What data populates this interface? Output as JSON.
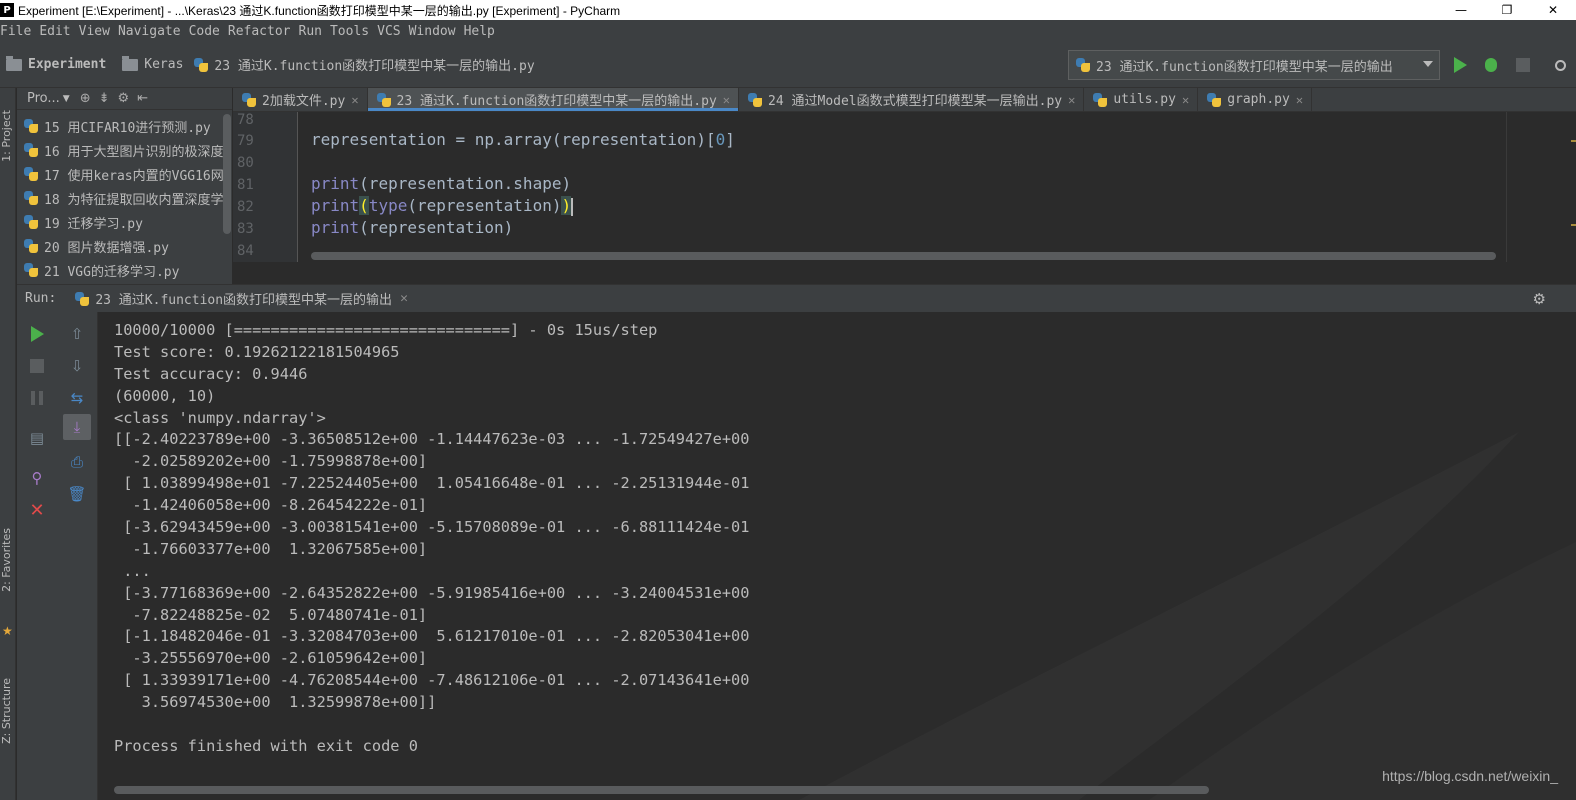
{
  "window": {
    "title": "Experiment [E:\\Experiment] - ...\\Keras\\23 通过K.function函数打印模型中某一层的输出.py [Experiment] - PyCharm",
    "controls": [
      "—",
      "❐",
      "✕"
    ]
  },
  "menu": [
    "File",
    "Edit",
    "View",
    "Navigate",
    "Code",
    "Refactor",
    "Run",
    "Tools",
    "VCS",
    "Window",
    "Help"
  ],
  "breadcrumb": {
    "project": "Experiment",
    "folder": "Keras",
    "file": "23 通过K.function函数打印模型中某一层的输出.py"
  },
  "run_config": {
    "label": "23 通过K.function函数打印模型中某一层的输出"
  },
  "project_panel": {
    "title": "Pro...",
    "items": [
      "15 用CIFAR10进行预测.py",
      "16 用于大型图片识别的极深度",
      "17 使用keras内置的VGG16网",
      "18 为特征提取回收内置深度学",
      "19 迁移学习.py",
      "20 图片数据增强.py",
      "21 VGG的迁移学习.py"
    ]
  },
  "side_strip": {
    "project": "1: Project",
    "favorites": "2: Favorites",
    "structure": "Z: Structure"
  },
  "tabs": [
    {
      "label": "2加载文件.py",
      "active": false
    },
    {
      "label": "23 通过K.function函数打印模型中某一层的输出.py",
      "active": true
    },
    {
      "label": "24 通过Model函数式模型打印模型某一层输出.py",
      "active": false
    },
    {
      "label": "utils.py",
      "active": false
    },
    {
      "label": "graph.py",
      "active": false
    }
  ],
  "editor": {
    "line_numbers": [
      "78",
      "79",
      "80",
      "81",
      "82",
      "83",
      "84"
    ],
    "line79": {
      "a": "representation = np.array(representation)[",
      "b": "0",
      "c": "]"
    },
    "line81": {
      "fn": "print",
      "rest": "(representation.shape)"
    },
    "line82": {
      "fn": "print",
      "open": "(",
      "fn2": "type",
      "mid": "(representation)",
      "close": ")"
    },
    "line83": {
      "fn": "print",
      "rest": "(representation)"
    }
  },
  "run_panel": {
    "label": "Run:",
    "tab": "23 通过K.function函数打印模型中某一层的输出"
  },
  "console": {
    "lines": [
      "10000/10000 [==============================] - 0s 15us/step",
      "Test score: 0.19262122181504965",
      "Test accuracy: 0.9446",
      "(60000, 10)",
      "<class 'numpy.ndarray'>",
      "[[-2.40223789e+00 -3.36508512e+00 -1.14447623e-03 ... -1.72549427e+00",
      "  -2.02589202e+00 -1.75998878e+00]",
      " [ 1.03899498e+01 -7.22524405e+00  1.05416648e-01 ... -2.25131944e-01",
      "  -1.42406058e+00 -8.26454222e-01]",
      " [-3.62943459e+00 -3.00381541e+00 -5.15708089e-01 ... -6.88111424e-01",
      "  -1.76603377e+00  1.32067585e+00]",
      " ...",
      " [-3.77168369e+00 -2.64352822e+00 -5.91985416e+00 ... -3.24004531e+00",
      "  -7.82248825e-02  5.07480741e-01]",
      " [-1.18482046e-01 -3.32084703e+00  5.61217010e-01 ... -2.82053041e+00",
      "  -3.25556970e+00 -2.61059642e+00]",
      " [ 1.33939171e+00 -4.76208544e+00 -7.48612106e-01 ... -2.07143641e+00",
      "   3.56974530e+00  1.32599878e+00]]",
      "",
      "Process finished with exit code 0"
    ],
    "watermark": "https://blog.csdn.net/weixin_"
  },
  "colors": {
    "accent": "#4a88c7",
    "run_green": "#4bb14b",
    "close_red": "#e04a4a"
  }
}
